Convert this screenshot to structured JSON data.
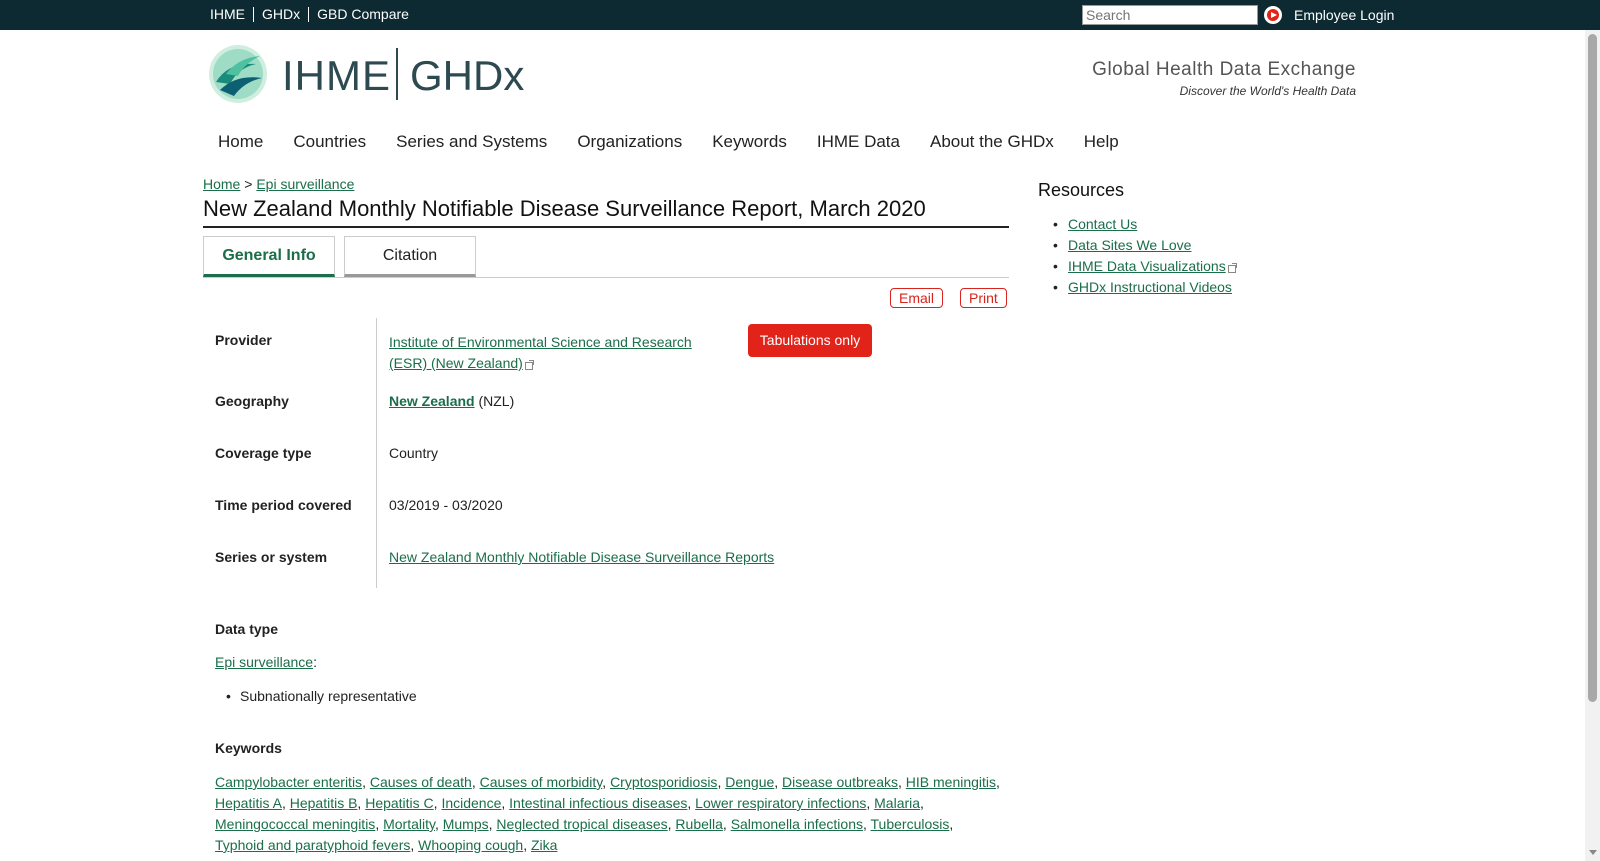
{
  "topbar": {
    "links": [
      "IHME",
      "GHDx",
      "GBD Compare"
    ],
    "search_placeholder": "Search",
    "login_label": "Employee Login"
  },
  "header": {
    "logo_ihme": "IHME",
    "logo_ghdx": "GHDx",
    "tagline": "Global Health Data Exchange",
    "subtagline": "Discover the World's Health Data"
  },
  "nav": {
    "items": [
      "Home",
      "Countries",
      "Series and Systems",
      "Organizations",
      "Keywords",
      "IHME Data",
      "About the GHDx",
      "Help"
    ]
  },
  "breadcrumb": {
    "home": "Home",
    "sep": ">",
    "section": "Epi surveillance"
  },
  "page_title": "New Zealand Monthly Notifiable Disease Surveillance Report, March 2020",
  "tabs": {
    "general": "General Info",
    "citation": "Citation"
  },
  "actions": {
    "email": "Email",
    "print": "Print"
  },
  "fields": {
    "provider_label": "Provider",
    "provider_line1": "Institute of Environmental Science and Research",
    "provider_line2": "(ESR) (New Zealand)",
    "tabulations": "Tabulations only",
    "geography_label": "Geography",
    "geography_link": "New Zealand",
    "geography_code": " (NZL)",
    "coverage_label": "Coverage type",
    "coverage_value": "Country",
    "time_label": "Time period covered",
    "time_value": "03/2019 - 03/2020",
    "series_label": "Series or system",
    "series_value": "New Zealand Monthly Notifiable Disease Surveillance Reports"
  },
  "datatype": {
    "heading": "Data type",
    "link": "Epi surveillance",
    "colon": ":",
    "bullet": "Subnationally representative"
  },
  "keywords": {
    "heading": "Keywords",
    "items": [
      "Campylobacter enteritis",
      "Causes of death",
      "Causes of morbidity",
      "Cryptosporidiosis",
      "Dengue",
      "Disease outbreaks",
      "HIB meningitis",
      "Hepatitis A",
      "Hepatitis B",
      "Hepatitis C",
      "Incidence",
      "Intestinal infectious diseases",
      "Lower respiratory infections",
      "Malaria",
      "Meningococcal meningitis",
      "Mortality",
      "Mumps",
      "Neglected tropical diseases",
      "Rubella",
      "Salmonella infections",
      "Tuberculosis",
      "Typhoid and paratyphoid fevers",
      "Whooping cough",
      "Zika"
    ]
  },
  "resources": {
    "heading": "Resources",
    "items": [
      "Contact Us",
      "Data Sites We Love",
      "IHME Data Visualizations",
      "GHDx Instructional Videos"
    ]
  },
  "colors": {
    "topbar": "#0d2a32",
    "link": "#1a6e4a",
    "accent_red": "#e2231a"
  }
}
